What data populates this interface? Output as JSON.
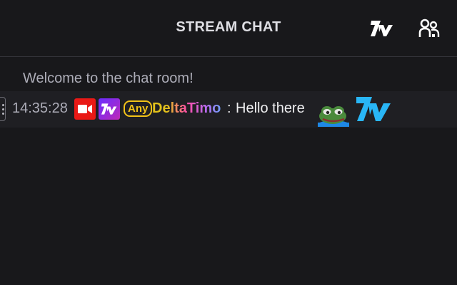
{
  "header": {
    "title": "STREAM CHAT",
    "emote_button_icon": "7tv-logo-icon",
    "users_button_icon": "users-icon"
  },
  "chat": {
    "welcome_text": "Welcome to the chat room!",
    "messages": [
      {
        "timestamp": "14:35:28",
        "badges": [
          {
            "name": "live-camera-badge-icon",
            "color": "#e91916"
          },
          {
            "name": "7tv-badge-icon",
            "color": "#8a2be2"
          },
          {
            "name": "any-badge",
            "text": "Any",
            "color": "#f2c318"
          }
        ],
        "username": "DeltaTimo",
        "separator": ":",
        "text": "Hello there",
        "emotes": [
          "frog-emote-icon",
          "7tv-logo-emote-icon"
        ]
      }
    ]
  },
  "colors": {
    "background": "#18181b",
    "row_highlight": "#1f1f23",
    "text": "#efeff1",
    "muted_text": "#adadb8",
    "accent_7tv": "#29b6f6"
  }
}
